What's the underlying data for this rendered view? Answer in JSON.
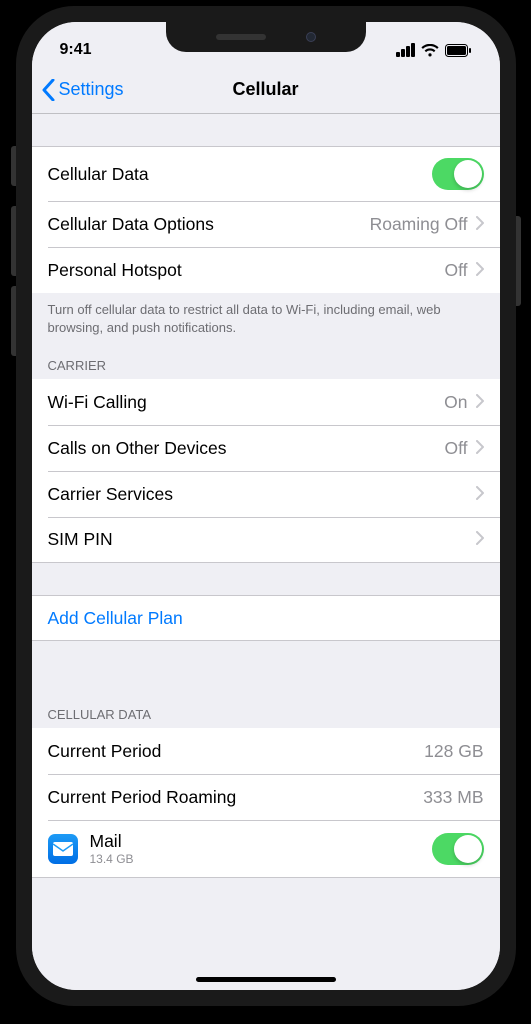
{
  "status": {
    "time": "9:41"
  },
  "nav": {
    "back": "Settings",
    "title": "Cellular"
  },
  "group1": {
    "cellular_data": "Cellular Data",
    "cellular_data_on": true,
    "options_label": "Cellular Data Options",
    "options_value": "Roaming Off",
    "hotspot_label": "Personal Hotspot",
    "hotspot_value": "Off",
    "footer": "Turn off cellular data to restrict all data to Wi-Fi, including email, web browsing, and push notifications."
  },
  "carrier": {
    "header": "Carrier",
    "wifi_calling_label": "Wi-Fi Calling",
    "wifi_calling_value": "On",
    "other_devices_label": "Calls on Other Devices",
    "other_devices_value": "Off",
    "carrier_services": "Carrier Services",
    "sim_pin": "SIM PIN"
  },
  "add_plan": "Add Cellular Plan",
  "data_usage": {
    "header": "Cellular Data",
    "current_period_label": "Current Period",
    "current_period_value": "128 GB",
    "roaming_label": "Current Period Roaming",
    "roaming_value": "333 MB"
  },
  "apps": {
    "mail_label": "Mail",
    "mail_usage": "13.4 GB",
    "mail_on": true
  }
}
